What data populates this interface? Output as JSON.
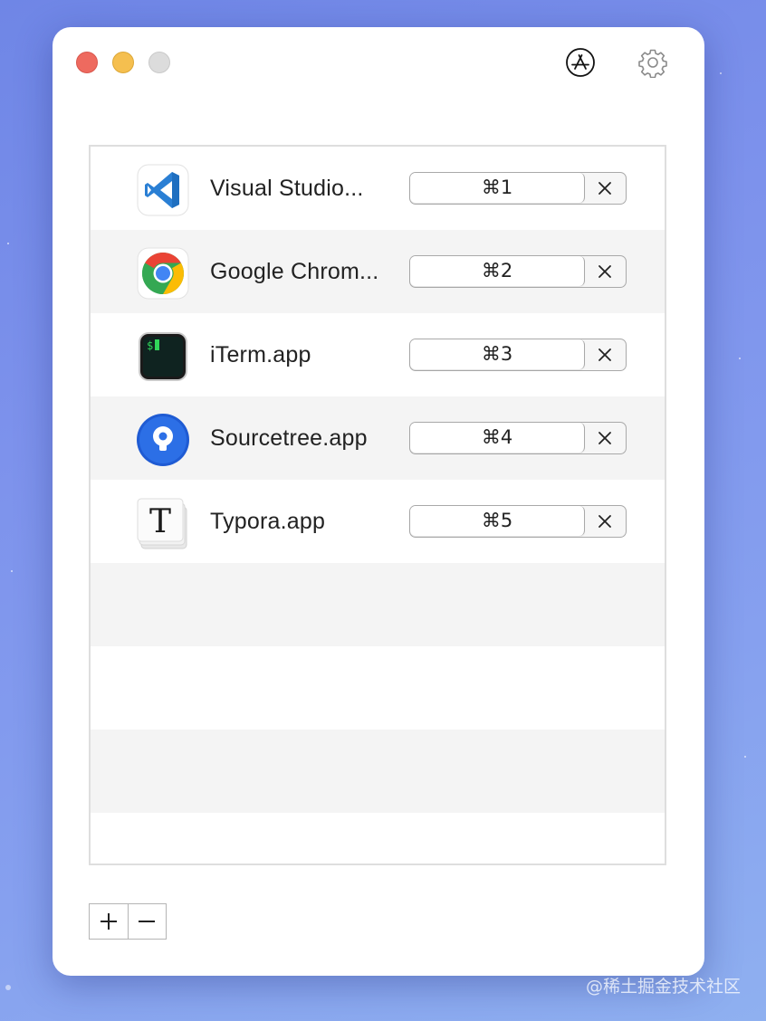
{
  "toolbar": {
    "app_store_icon": "app-store-icon",
    "settings_icon": "gear-icon"
  },
  "apps": [
    {
      "name": "Visual Studio...",
      "shortcut": "⌘1",
      "icon": "vscode-icon"
    },
    {
      "name": "Google Chrom...",
      "shortcut": "⌘2",
      "icon": "chrome-icon"
    },
    {
      "name": "iTerm.app",
      "shortcut": "⌘3",
      "icon": "iterm-icon"
    },
    {
      "name": "Sourcetree.app",
      "shortcut": "⌘4",
      "icon": "sourcetree-icon"
    },
    {
      "name": "Typora.app",
      "shortcut": "⌘5",
      "icon": "typora-icon"
    }
  ],
  "footer": {
    "add_label": "+",
    "remove_label": "−"
  },
  "watermark": "@稀土掘金技术社区",
  "colors": {
    "close": "#ee6a5f",
    "minimize": "#f5bf4f",
    "zoom": "#dcdcdc",
    "row_alt": "#f4f4f4"
  }
}
